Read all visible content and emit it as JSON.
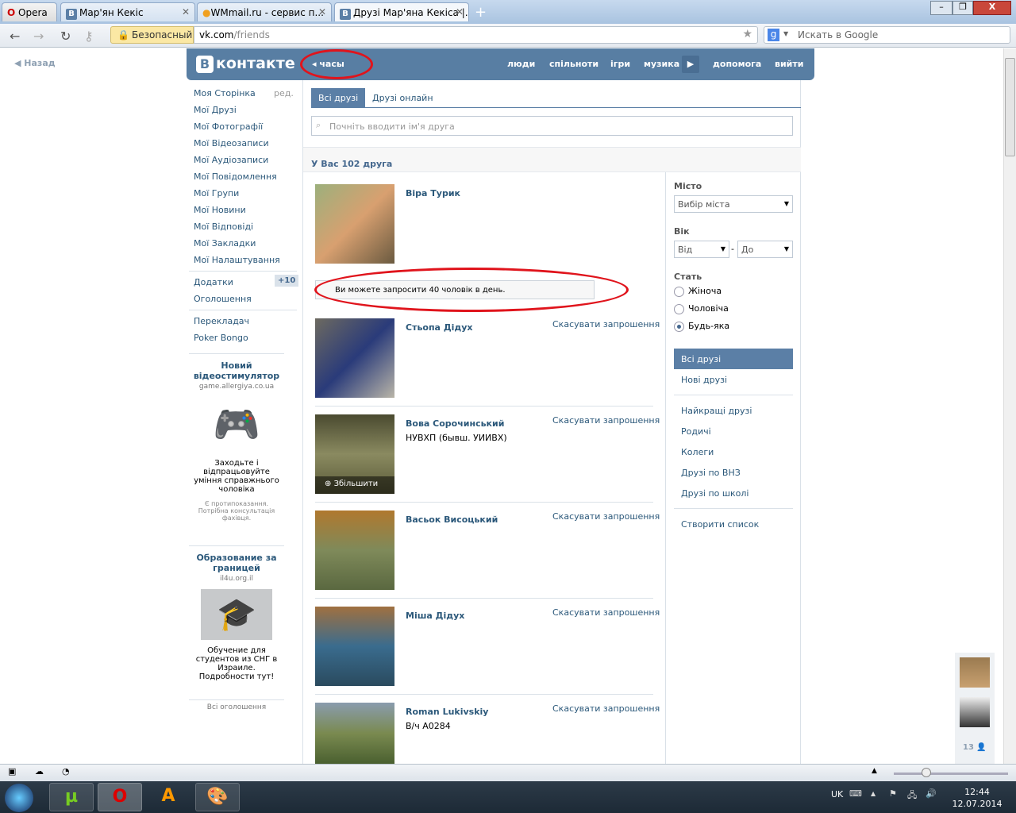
{
  "browser": {
    "opera_label": "Opera",
    "tabs": [
      {
        "label": "Мар'ян Кекіс"
      },
      {
        "label": "WMmail.ru - сервис п..."
      },
      {
        "label": "Друзі Мар'яна Кекіса |..."
      }
    ],
    "secure_label": "Безопасный",
    "url_host": "vk.com",
    "url_path": "/friends",
    "search_placeholder": "Искать в Google"
  },
  "back_label": "Назад",
  "header": {
    "logo": "контакте",
    "logo_letter": "В",
    "back_link": "часы",
    "nav": [
      "люди",
      "спільноти",
      "ігри",
      "музика",
      "допомога",
      "вийти"
    ]
  },
  "left_menu": {
    "items": [
      "Моя Сторінка",
      "Мої Друзі",
      "Мої Фотографії",
      "Мої Відеозаписи",
      "Мої Аудіозаписи",
      "Мої Повідомлення",
      "Мої Групи",
      "Мої Новини",
      "Мої Відповіді",
      "Мої Закладки",
      "Мої Налаштування"
    ],
    "edit": "ред.",
    "apps": "Додатки",
    "apps_badge": "+10",
    "ads": "Оголошення",
    "extra": [
      "Перекладач",
      "Poker Bongo"
    ]
  },
  "ads": [
    {
      "title": "Новий відеостимулятор",
      "domain": "game.allergiya.co.ua",
      "text": "Заходьте і відпрацьовуйте уміння справжнього чоловіка",
      "note": "Є протипоказання. Потрібна консультація фахівця."
    },
    {
      "title": "Образование за границей",
      "domain": "il4u.org.il",
      "text": "Обучение для студентов из СНГ в Израиле. Подробности тут!"
    }
  ],
  "all_ads": "Всі оголошення",
  "main": {
    "tabs": [
      "Всі друзі",
      "Друзі онлайн"
    ],
    "search_placeholder": "Почніть вводити ім'я друга",
    "count_label": "У Вас 102 друга",
    "invite_notice": "Ви можете запросити 40 чоловік в день.",
    "cancel_label": "Скасувати запрошення",
    "zoom_label": "Збільшити",
    "friends": [
      {
        "name": "Віра Турик",
        "sub": ""
      },
      {
        "name": "Стьопа Дідух",
        "sub": ""
      },
      {
        "name": "Вова Сорочинський",
        "sub": "НУВХП (бывш. УИИВХ)"
      },
      {
        "name": "Васьок Висоцький",
        "sub": ""
      },
      {
        "name": "Міша Дідух",
        "sub": ""
      },
      {
        "name": "Roman Lukivskiy",
        "sub": "В/ч А0284"
      }
    ]
  },
  "filters": {
    "city_label": "Місто",
    "city_value": "Вибір міста",
    "age_label": "Вік",
    "age_from": "Від",
    "age_to": "До",
    "sex_label": "Стать",
    "sex_options": [
      "Жіноча",
      "Чоловіча",
      "Будь-яка"
    ],
    "lists": [
      "Всі друзі",
      "Нові друзі",
      "Найкращі друзі",
      "Родичі",
      "Колеги",
      "Друзі по ВНЗ",
      "Друзі по школі",
      "Створити список"
    ]
  },
  "online_count": "13",
  "taskbar": {
    "lang": "UK",
    "time": "12:44",
    "date": "12.07.2014"
  }
}
